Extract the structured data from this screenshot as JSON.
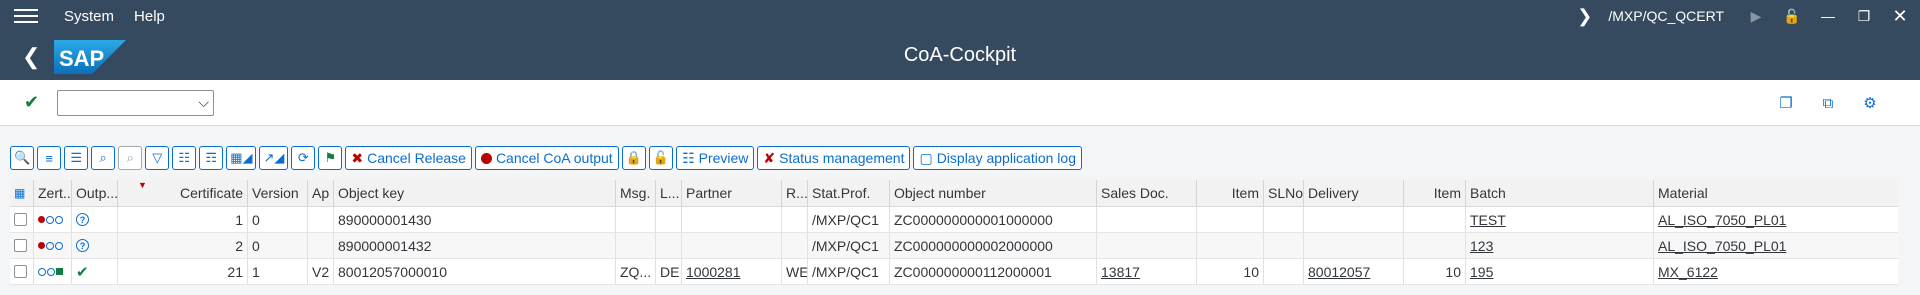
{
  "menu": {
    "items": [
      "System",
      "Help"
    ],
    "transaction": "/MXP/QC_QCERT"
  },
  "title": {
    "text": "CoA-Cockpit",
    "logo": "SAP"
  },
  "toolbar": {
    "cancel_release": "Cancel Release",
    "cancel_coa_output": "Cancel CoA output",
    "preview": "Preview",
    "status_management": "Status management",
    "display_log": "Display application log"
  },
  "grid": {
    "headers": {
      "zert": "Zert...",
      "outp": "Outp...",
      "certificate": "Certificate",
      "version": "Version",
      "ap": "Ap",
      "object_key": "Object key",
      "msg": "Msg.",
      "l": "L...",
      "partner": "Partner",
      "r": "R...",
      "stat_prof": "Stat.Prof.",
      "object_number": "Object number",
      "sales_doc": "Sales Doc.",
      "item": "Item",
      "slno": "SLNo",
      "delivery": "Delivery",
      "item2": "Item",
      "batch": "Batch",
      "material": "Material"
    },
    "rows": [
      {
        "certificate": "1",
        "version": "0",
        "ap": "",
        "object_key": "890000001430",
        "msg": "",
        "l": "",
        "partner": "",
        "r": "",
        "stat_prof": "/MXP/QC1",
        "object_number": "ZC000000000001000000",
        "sales_doc": "",
        "item": "",
        "slno": "",
        "delivery": "",
        "item2": "",
        "batch": "TEST",
        "material": "AL_ISO_7050_PL01"
      },
      {
        "certificate": "2",
        "version": "0",
        "ap": "",
        "object_key": "890000001432",
        "msg": "",
        "l": "",
        "partner": "",
        "r": "",
        "stat_prof": "/MXP/QC1",
        "object_number": "ZC000000000002000000",
        "sales_doc": "",
        "item": "",
        "slno": "",
        "delivery": "",
        "item2": "",
        "batch": "123",
        "material": "AL_ISO_7050_PL01"
      },
      {
        "certificate": "21",
        "version": "1",
        "ap": "V2",
        "object_key": "80012057000010",
        "msg": "ZQ...",
        "l": "DE",
        "partner": "1000281",
        "r": "WE",
        "stat_prof": "/MXP/QC1",
        "object_number": "ZC000000000112000001",
        "sales_doc": "13817",
        "item": "10",
        "slno": "",
        "delivery": "80012057",
        "item2": "10",
        "batch": "195",
        "material": "MX_6122"
      }
    ]
  }
}
